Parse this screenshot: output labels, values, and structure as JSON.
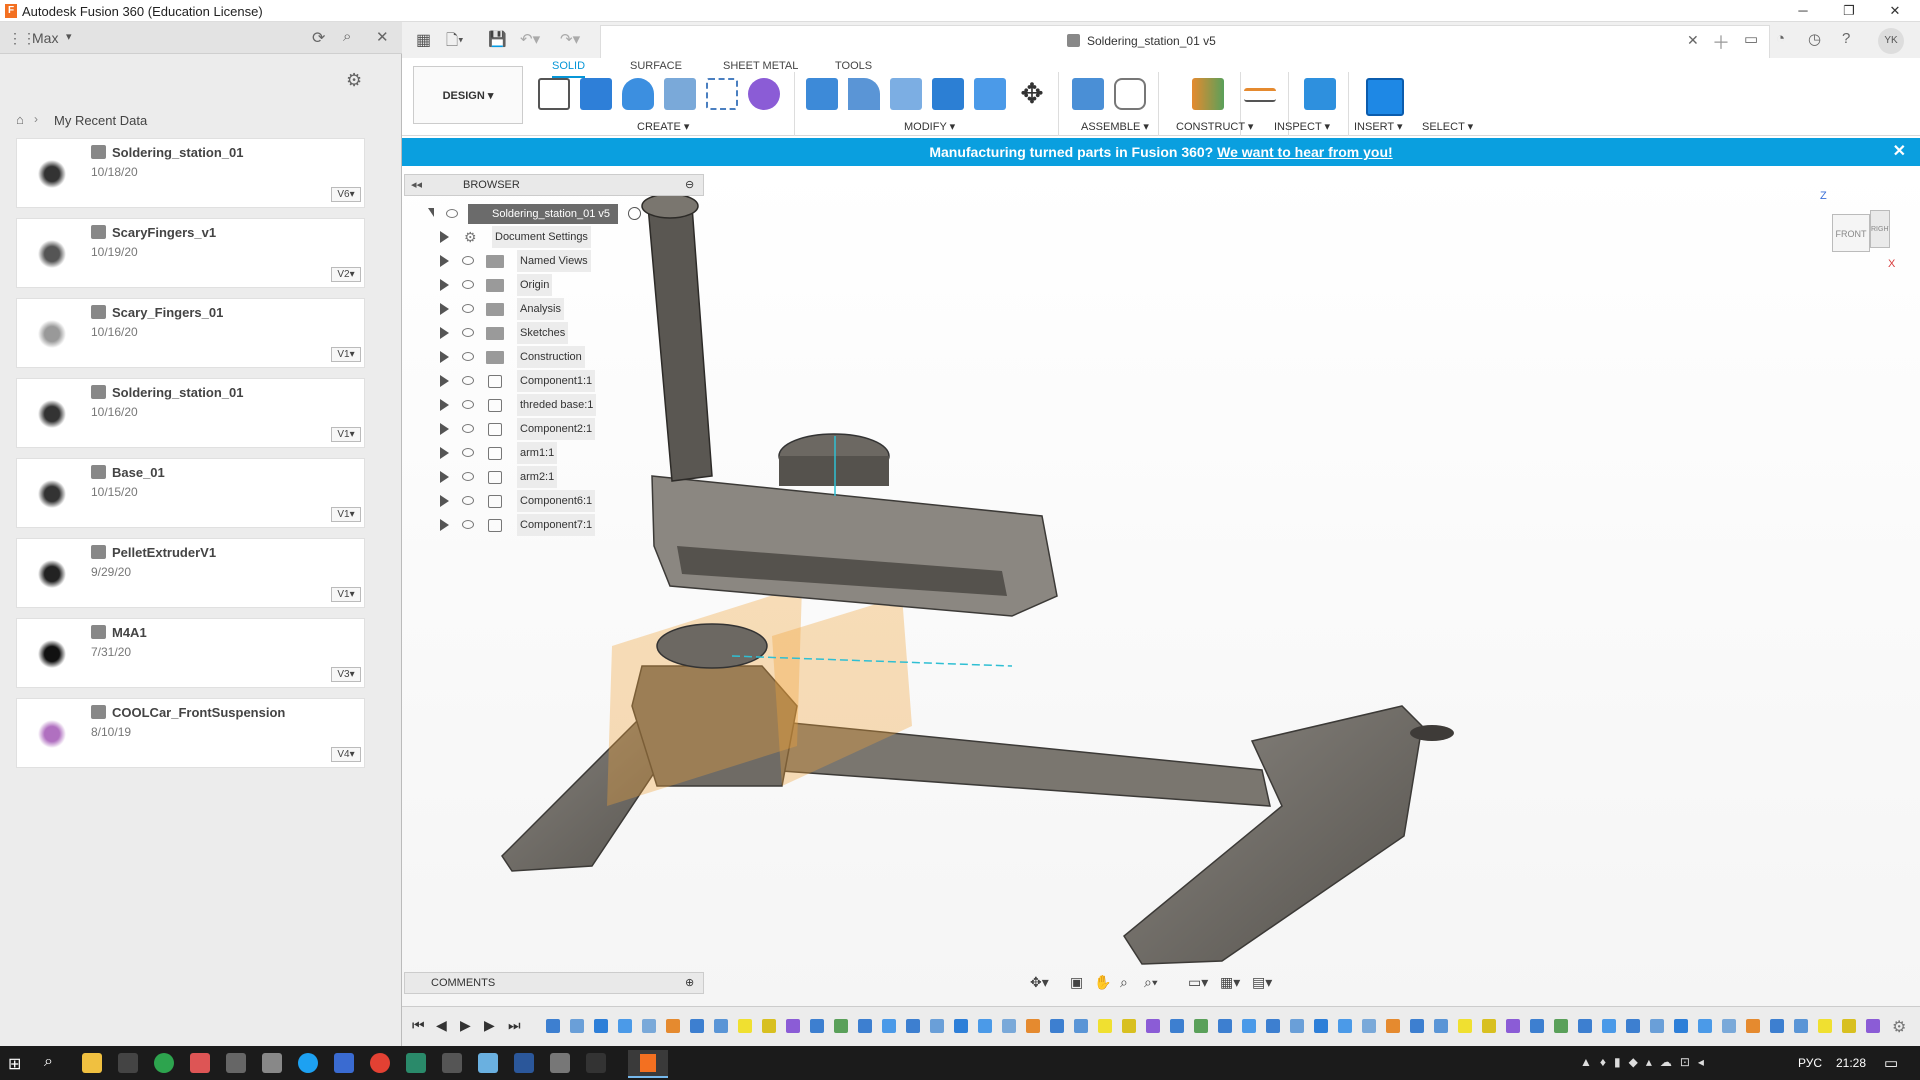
{
  "window": {
    "title": "Autodesk Fusion 360 (Education License)",
    "logo": "F"
  },
  "datapanel": {
    "user": "Max",
    "breadcrumb": "My Recent Data",
    "items": [
      {
        "name": "Soldering_station_01",
        "date": "10/18/20",
        "version": "V6"
      },
      {
        "name": "ScaryFingers_v1",
        "date": "10/19/20",
        "version": "V2"
      },
      {
        "name": "Scary_Fingers_01",
        "date": "10/16/20",
        "version": "V1"
      },
      {
        "name": "Soldering_station_01",
        "date": "10/16/20",
        "version": "V1"
      },
      {
        "name": "Base_01",
        "date": "10/15/20",
        "version": "V1"
      },
      {
        "name": "PelletExtruderV1",
        "date": "9/29/20",
        "version": "V1"
      },
      {
        "name": "M4A1",
        "date": "7/31/20",
        "version": "V3"
      },
      {
        "name": "COOLCar_FrontSuspension",
        "date": "8/10/19",
        "version": "V4"
      }
    ]
  },
  "document": {
    "tab_title": "Soldering_station_01 v5",
    "avatar": "YK"
  },
  "ribbon": {
    "tabs": [
      "SOLID",
      "SURFACE",
      "SHEET METAL",
      "TOOLS"
    ],
    "workspace": "DESIGN ▾",
    "groups": [
      "CREATE ▾",
      "MODIFY ▾",
      "ASSEMBLE ▾",
      "CONSTRUCT ▾",
      "INSPECT ▾",
      "INSERT ▾",
      "SELECT ▾"
    ]
  },
  "banner": {
    "text": "Manufacturing turned parts in Fusion 360?",
    "link": "We want to hear from you!"
  },
  "browser": {
    "title": "BROWSER",
    "root": "Soldering_station_01 v5",
    "nodes": [
      {
        "label": "Document Settings",
        "kind": "gear"
      },
      {
        "label": "Named Views",
        "kind": "folder"
      },
      {
        "label": "Origin",
        "kind": "folder"
      },
      {
        "label": "Analysis",
        "kind": "folder"
      },
      {
        "label": "Sketches",
        "kind": "folder"
      },
      {
        "label": "Construction",
        "kind": "folder"
      },
      {
        "label": "Component1:1",
        "kind": "comp"
      },
      {
        "label": "threded base:1",
        "kind": "comp"
      },
      {
        "label": "Component2:1",
        "kind": "comp"
      },
      {
        "label": "arm1:1",
        "kind": "comp"
      },
      {
        "label": "arm2:1",
        "kind": "comp"
      },
      {
        "label": "Component6:1",
        "kind": "comp"
      },
      {
        "label": "Component7:1",
        "kind": "comp"
      }
    ]
  },
  "comments": {
    "title": "COMMENTS"
  },
  "viewcube": {
    "front": "FRONT",
    "right": "RIGHT",
    "z": "Z",
    "x": "X"
  },
  "taskbar": {
    "lang": "РУС",
    "time": "21:28"
  },
  "colors": {
    "accent": "#0696d7",
    "banner": "#0a9fdf",
    "model": "#6e6b66"
  }
}
